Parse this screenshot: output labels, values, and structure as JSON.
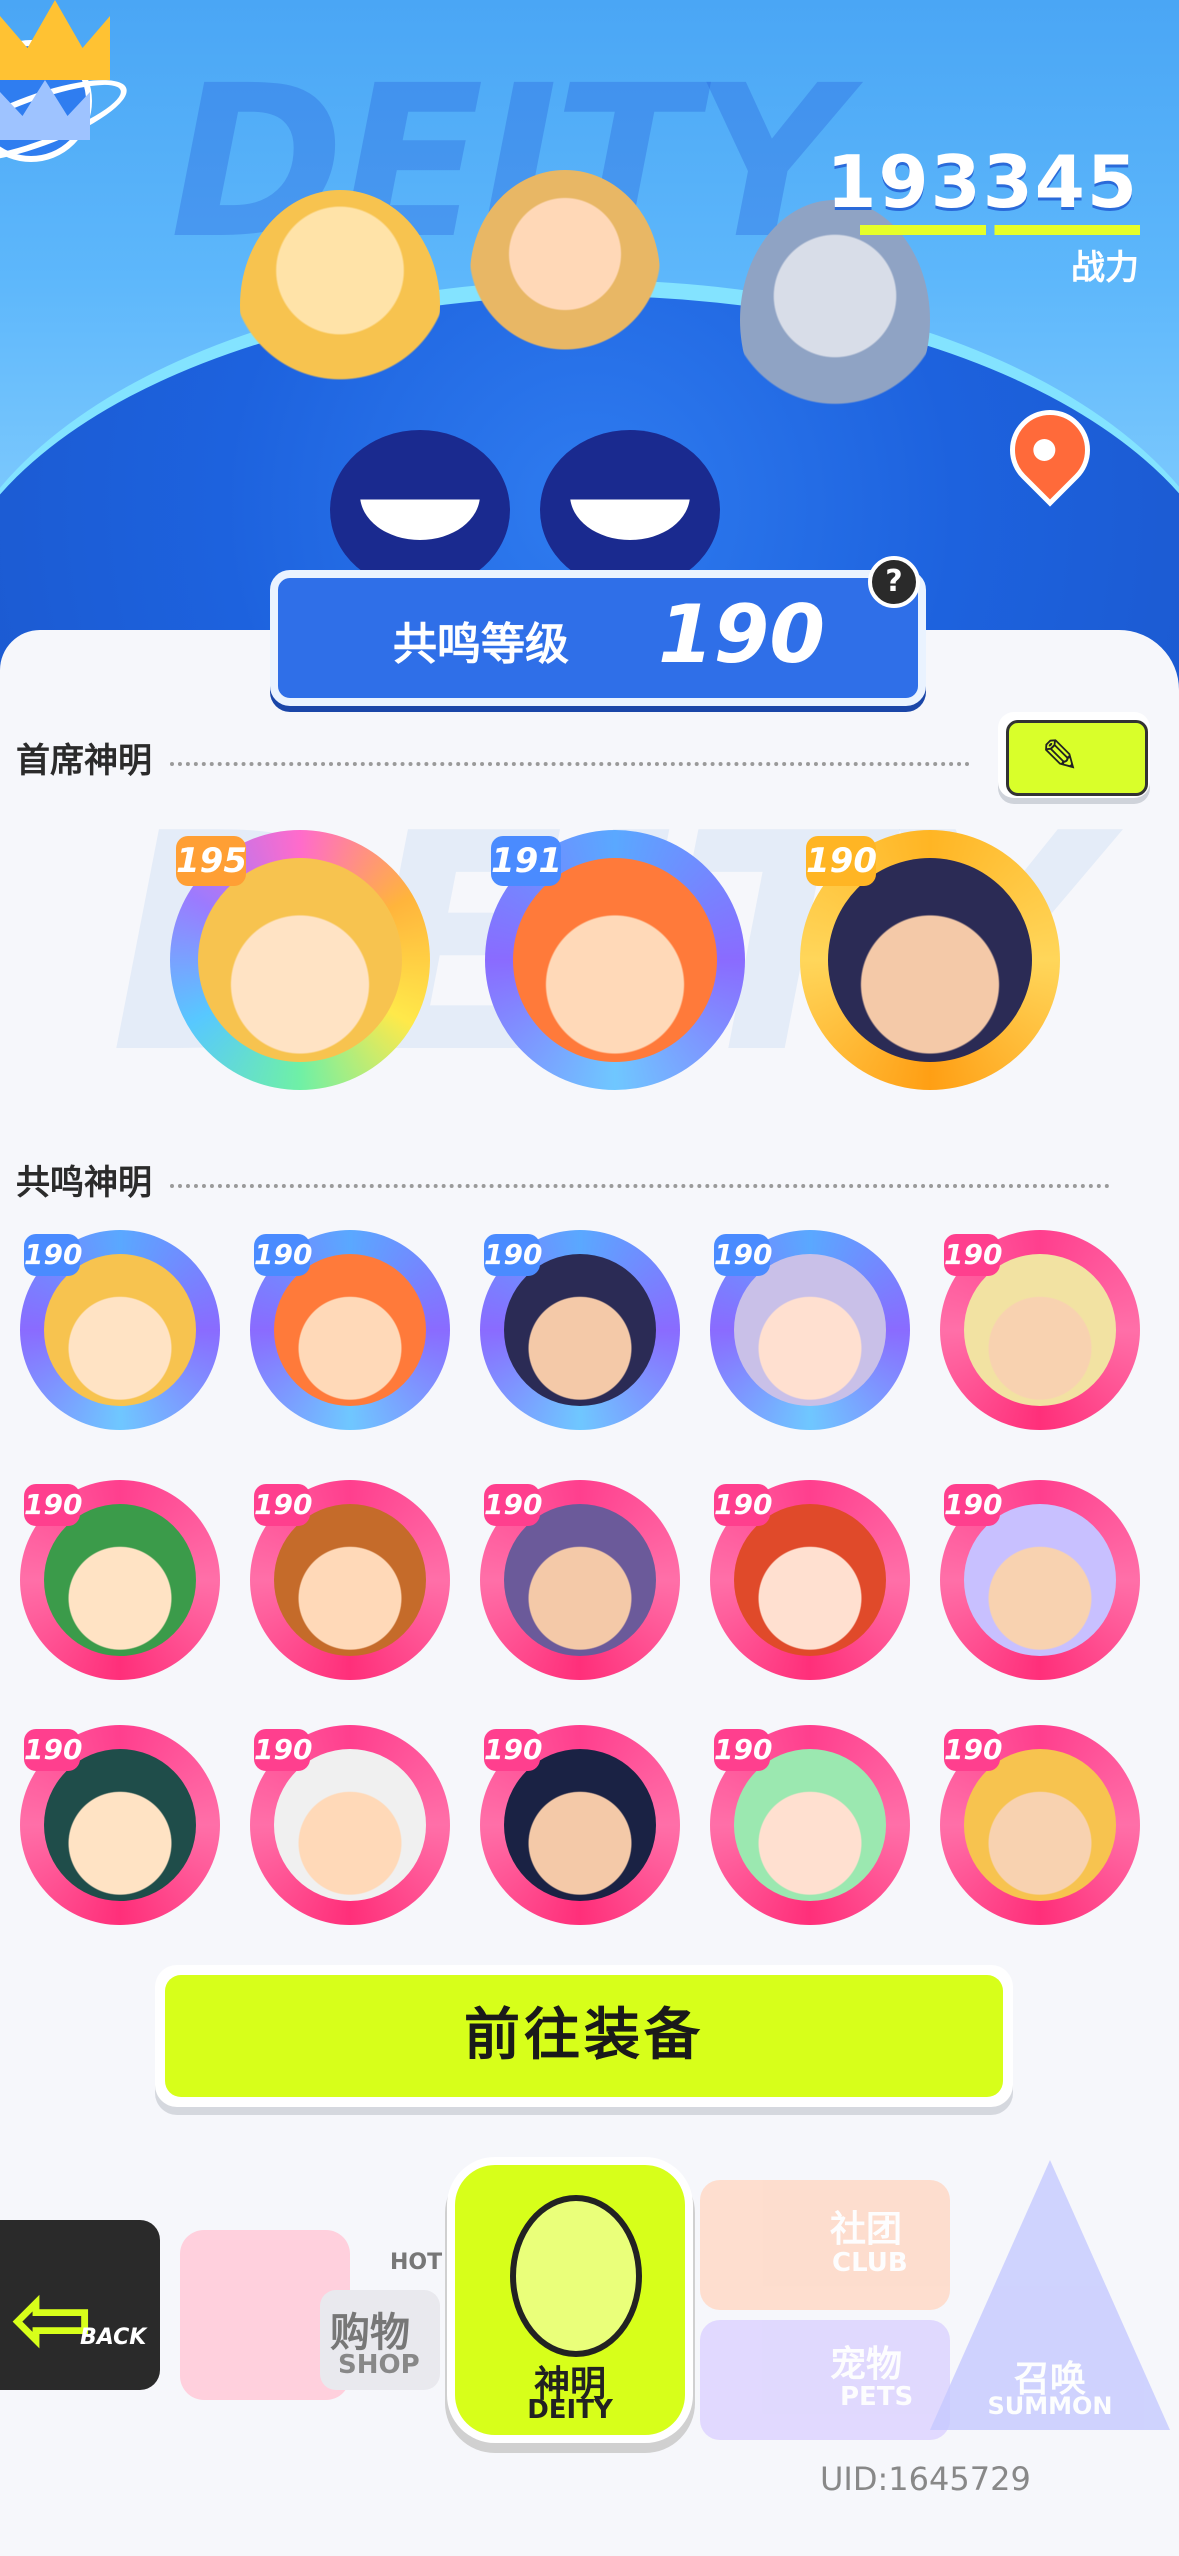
{
  "banner": {
    "bg_word": "DEITY",
    "power_value": "193345",
    "power_label": "战力",
    "resonance_label": "共鸣等级",
    "resonance_value": "190",
    "help_icon": "?"
  },
  "sections": {
    "chief_title": "首席神明",
    "resonance_title": "共鸣神明",
    "watermark": "DEITY"
  },
  "chief_deities": [
    {
      "level": "195",
      "frame": "rainbow"
    },
    {
      "level": "191",
      "frame": "blue"
    },
    {
      "level": "190",
      "frame": "gold",
      "crown": true
    }
  ],
  "resonance_deities": [
    {
      "level": "190",
      "frame": "blue"
    },
    {
      "level": "190",
      "frame": "blue"
    },
    {
      "level": "190",
      "frame": "blue",
      "crown": true
    },
    {
      "level": "190",
      "frame": "blue"
    },
    {
      "level": "190",
      "frame": "pink"
    },
    {
      "level": "190",
      "frame": "pink"
    },
    {
      "level": "190",
      "frame": "pink"
    },
    {
      "level": "190",
      "frame": "pink"
    },
    {
      "level": "190",
      "frame": "pink"
    },
    {
      "level": "190",
      "frame": "pink"
    },
    {
      "level": "190",
      "frame": "pink"
    },
    {
      "level": "190",
      "frame": "pink"
    },
    {
      "level": "190",
      "frame": "pink"
    },
    {
      "level": "190",
      "frame": "pink"
    },
    {
      "level": "190",
      "frame": "pink"
    }
  ],
  "go_button_label": "前往装备",
  "nav": {
    "back_label": "BACK",
    "shop_cn": "购物",
    "shop_en": "SHOP",
    "shop_badge": "HOT!",
    "deity_cn": "神明",
    "deity_en": "DEITY",
    "club_cn": "社团",
    "club_en": "CLUB",
    "pets_cn": "宠物",
    "pets_en": "PETS",
    "summon_cn": "召唤",
    "summon_en": "SUMMON"
  },
  "uid": "UID:1645729",
  "colors": {
    "accent_lime": "#d7ff1a",
    "banner_blue": "#2f6fe8",
    "frame_pink": "#ff3f8e",
    "frame_blue": "#5aa8ff",
    "frame_gold": "#ffb524"
  },
  "icons": {
    "edit": "pencil-icon",
    "back": "arrow-left-icon",
    "location": "location-pin-icon",
    "planet": "planet-icon",
    "crown": "crown-icon"
  }
}
